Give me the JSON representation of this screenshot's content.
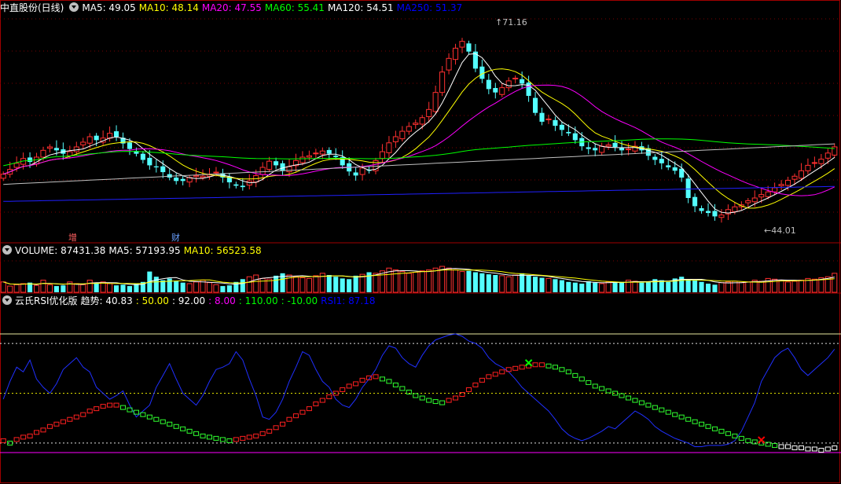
{
  "stock": {
    "name": "中直股份(日线)"
  },
  "headers": {
    "main": [
      {
        "label": "MA5",
        "value": "49.05",
        "color": "#ffffff"
      },
      {
        "label": "MA10",
        "value": "48.14",
        "color": "#ffff00"
      },
      {
        "label": "MA20",
        "value": "47.55",
        "color": "#ff00ff"
      },
      {
        "label": "MA60",
        "value": "55.41",
        "color": "#00ff00"
      },
      {
        "label": "MA120",
        "value": "54.51",
        "color": "#ffffff"
      },
      {
        "label": "MA250",
        "value": "51.37",
        "color": "#0000ff"
      }
    ],
    "volume": [
      {
        "label": "VOLUME",
        "value": "87431.38",
        "color": "#ffffff"
      },
      {
        "label": "MA5",
        "value": "57193.95",
        "color": "#ffffff"
      },
      {
        "label": "MA10",
        "value": "56523.58",
        "color": "#ffff00"
      }
    ],
    "indicator_name": "云氏RSI优化版",
    "indicator": [
      {
        "label": "趋势",
        "value": "40.83",
        "color": "#ffffff"
      },
      {
        "label": "",
        "value": "50.00",
        "color": "#ffff00"
      },
      {
        "label": "",
        "value": "92.00",
        "color": "#ffffff"
      },
      {
        "label": "",
        "value": "8.00",
        "color": "#ff00ff"
      },
      {
        "label": "",
        "value": "110.00",
        "color": "#00ff00"
      },
      {
        "label": "",
        "value": "-10.00",
        "color": "#00ff00"
      },
      {
        "label": "RSI1",
        "value": "87.18",
        "color": "#0000ff"
      }
    ]
  },
  "markers": {
    "zeng": "增",
    "cai": "财",
    "high": "71.16",
    "low": "44.01"
  },
  "chart_data": {
    "type": "candlestick",
    "days": 126,
    "price_range": [
      41,
      74
    ],
    "high": 71.16,
    "low": 44.01,
    "closes": [
      50.5,
      51.2,
      52.1,
      52.8,
      52.3,
      53.0,
      54.0,
      54.5,
      54.0,
      53.5,
      53.8,
      54.5,
      55.2,
      56.0,
      55.5,
      55.8,
      56.5,
      56.0,
      55.0,
      54.2,
      53.5,
      52.6,
      51.8,
      51.5,
      50.8,
      50.0,
      49.5,
      49.5,
      50.0,
      50.3,
      50.2,
      50.5,
      50.8,
      50.0,
      49.3,
      48.8,
      48.6,
      49.5,
      50.3,
      51.5,
      52.4,
      51.8,
      51.0,
      51.6,
      52.5,
      53.0,
      53.2,
      53.6,
      53.9,
      53.5,
      53.0,
      51.8,
      50.9,
      50.3,
      51.4,
      51.0,
      52.5,
      53.8,
      55.1,
      56.0,
      56.8,
      57.5,
      58.0,
      58.8,
      60.0,
      62.5,
      65.5,
      67.5,
      69.0,
      70.0,
      68.5,
      66.0,
      64.5,
      63.0,
      62.5,
      63.2,
      64.2,
      64.6,
      63.8,
      62.0,
      59.5,
      58.2,
      58.6,
      57.6,
      57.0,
      56.5,
      55.5,
      54.6,
      54.2,
      54.0,
      54.6,
      54.8,
      54.5,
      54.0,
      54.2,
      54.6,
      54.0,
      53.2,
      52.6,
      52.1,
      51.5,
      51.0,
      50.0,
      47.0,
      45.8,
      45.1,
      44.8,
      44.3,
      44.5,
      45.3,
      45.7,
      46.0,
      46.6,
      47.0,
      47.5,
      47.9,
      48.5,
      49.0,
      49.6,
      50.2,
      51.0,
      51.8,
      52.2,
      52.7,
      53.6,
      54.51
    ],
    "ma250": [
      46.5,
      48.7
    ],
    "volume": [
      30,
      18,
      22,
      25,
      28,
      20,
      35,
      22,
      18,
      20,
      30,
      25,
      22,
      35,
      28,
      30,
      25,
      20,
      22,
      18,
      25,
      30,
      60,
      45,
      35,
      40,
      32,
      28,
      25,
      30,
      35,
      28,
      22,
      18,
      20,
      30,
      38,
      45,
      50,
      40,
      38,
      48,
      55,
      50,
      45,
      42,
      40,
      48,
      55,
      50,
      45,
      40,
      38,
      48,
      52,
      58,
      55,
      62,
      70,
      65,
      60,
      55,
      58,
      62,
      65,
      70,
      75,
      70,
      65,
      60,
      62,
      58,
      55,
      52,
      50,
      48,
      45,
      50,
      55,
      48,
      45,
      42,
      40,
      38,
      35,
      30,
      28,
      25,
      32,
      28,
      25,
      30,
      28,
      30,
      35,
      32,
      28,
      30,
      38,
      35,
      30,
      40,
      45,
      38,
      35,
      30,
      25,
      22,
      28,
      30,
      32,
      28,
      30,
      35,
      32,
      40,
      38,
      35,
      30,
      32,
      35,
      40,
      38,
      42,
      45,
      55
    ],
    "vol_max": 100,
    "rsi": [
      45,
      60,
      72,
      68,
      78,
      62,
      55,
      50,
      58,
      70,
      75,
      80,
      72,
      68,
      55,
      50,
      45,
      48,
      52,
      40,
      30,
      35,
      40,
      55,
      65,
      75,
      62,
      50,
      45,
      40,
      48,
      60,
      70,
      72,
      75,
      85,
      78,
      62,
      48,
      30,
      28,
      34,
      45,
      60,
      72,
      85,
      82,
      70,
      60,
      55,
      45,
      40,
      38,
      45,
      55,
      62,
      70,
      82,
      90,
      88,
      80,
      75,
      72,
      82,
      90,
      95,
      97,
      99,
      100,
      98,
      94,
      92,
      88,
      80,
      75,
      72,
      68,
      62,
      55,
      50,
      45,
      40,
      35,
      28,
      20,
      15,
      12,
      10,
      12,
      15,
      18,
      22,
      20,
      25,
      30,
      35,
      32,
      28,
      22,
      18,
      15,
      12,
      10,
      8,
      5,
      5,
      6,
      6,
      6,
      7,
      10,
      18,
      30,
      42,
      60,
      70,
      80,
      85,
      88,
      80,
      70,
      65,
      70,
      75,
      80,
      87.18
    ],
    "trend": [
      10,
      8,
      11,
      13,
      14,
      17,
      19,
      22,
      24,
      26,
      28,
      30,
      32,
      35,
      37,
      39,
      40,
      40,
      38,
      36,
      34,
      32,
      30,
      28,
      26,
      24,
      22,
      20,
      18,
      16,
      14,
      13,
      12,
      11,
      10,
      11,
      12,
      13,
      14,
      16,
      18,
      21,
      24,
      28,
      31,
      34,
      37,
      41,
      44,
      47,
      50,
      53,
      56,
      58,
      61,
      63,
      64,
      62,
      60,
      57,
      54,
      51,
      48,
      46,
      44,
      43,
      42,
      44,
      46,
      49,
      53,
      57,
      61,
      64,
      66,
      68,
      70,
      71,
      72,
      73,
      74,
      74,
      73,
      72,
      70,
      68,
      65,
      62,
      59,
      56,
      54,
      52,
      50,
      48,
      46,
      44,
      42,
      40,
      38,
      36,
      34,
      32,
      30,
      28,
      26,
      24,
      22,
      20,
      18,
      16,
      14,
      12,
      10,
      9,
      8,
      7,
      6,
      5,
      5,
      4,
      4,
      3,
      3,
      2,
      3,
      4
    ],
    "bands": {
      "upper": 100,
      "mid": 50,
      "hi": 92,
      "lo": 8,
      "floor": 0
    },
    "signals": [
      {
        "index": 79,
        "type": "cross",
        "color": "#00ff00"
      },
      {
        "index": 114,
        "type": "cross",
        "color": "#ff0000"
      }
    ]
  }
}
